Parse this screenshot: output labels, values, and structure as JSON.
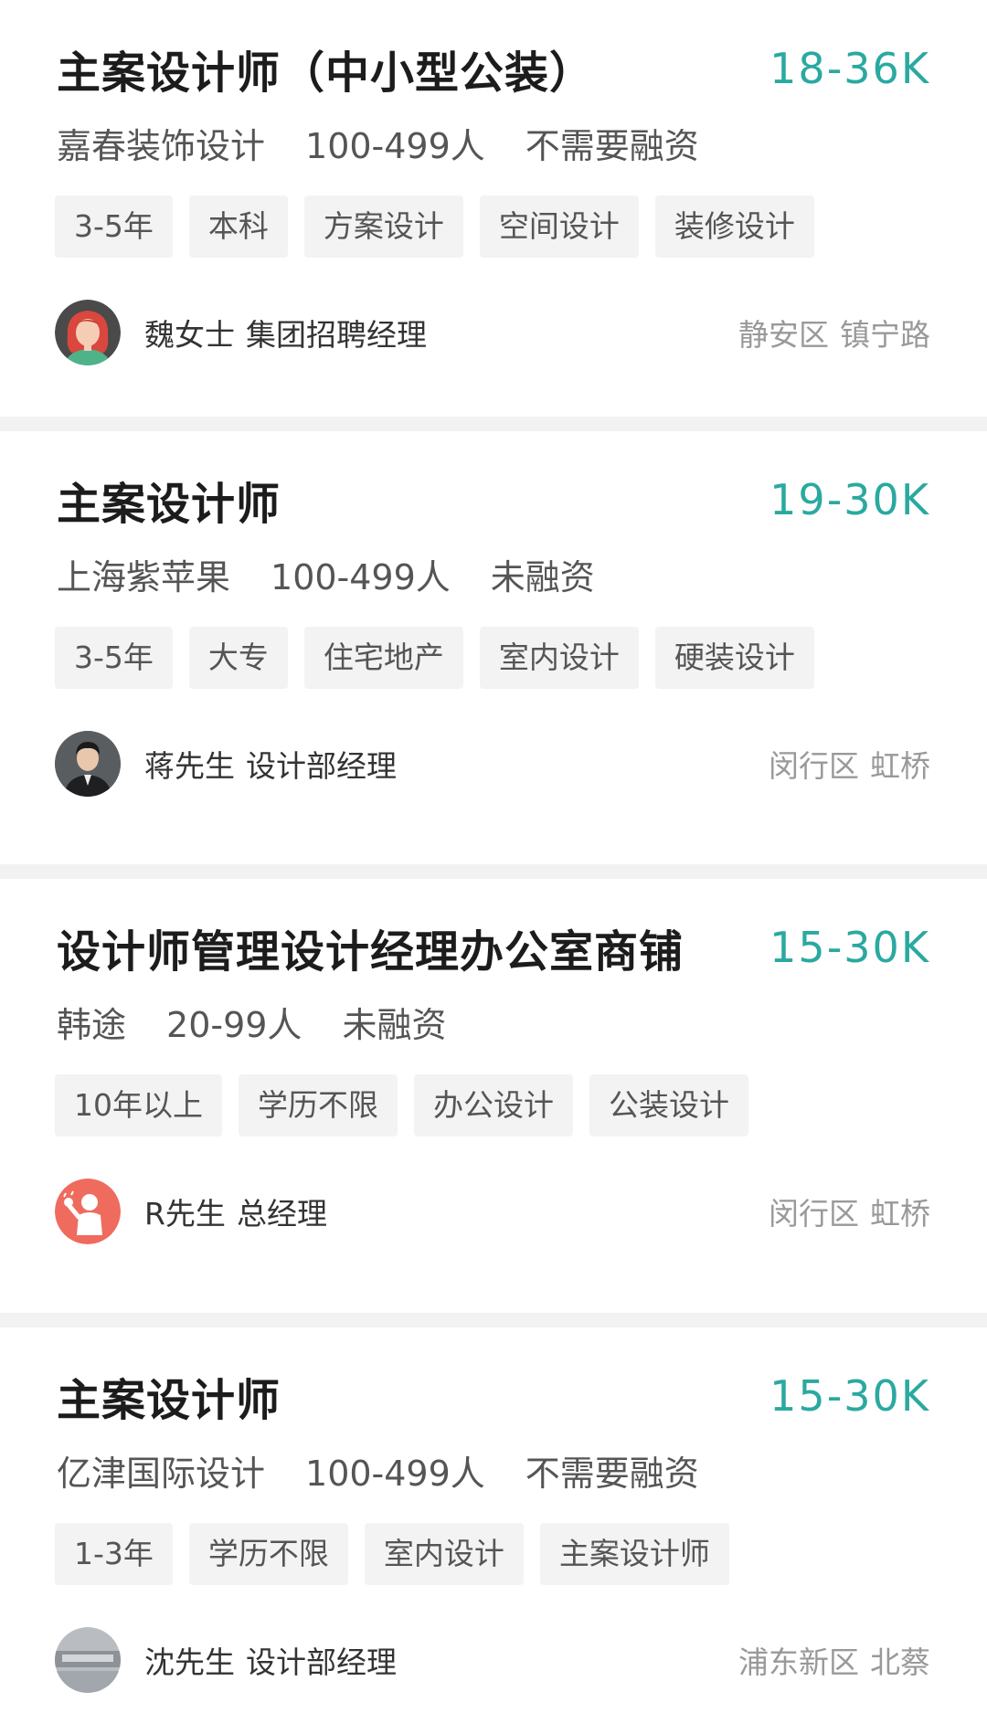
{
  "jobs": [
    {
      "title": "主案设计师（中小型公装）",
      "salary": "18-36K",
      "company": "嘉春装饰设计",
      "size": "100-499人",
      "funding": "不需要融资",
      "tags": [
        "3-5年",
        "本科",
        "方案设计",
        "空间设计",
        "装修设计"
      ],
      "recruiter_name": "魏女士",
      "recruiter_title": "集团招聘经理",
      "district": "静安区",
      "area": "镇宁路",
      "avatar_icon": "woman-avatar-icon"
    },
    {
      "title": "主案设计师",
      "salary": "19-30K",
      "company": "上海紫苹果",
      "size": "100-499人",
      "funding": "未融资",
      "tags": [
        "3-5年",
        "大专",
        "住宅地产",
        "室内设计",
        "硬装设计"
      ],
      "recruiter_name": "蒋先生",
      "recruiter_title": "设计部经理",
      "district": "闵行区",
      "area": "虹桥",
      "avatar_icon": "man-photo-avatar-icon"
    },
    {
      "title": "设计师管理设计经理办公室商铺",
      "salary": "15-30K",
      "company": "韩途",
      "size": "20-99人",
      "funding": "未融资",
      "tags": [
        "10年以上",
        "学历不限",
        "办公设计",
        "公装设计"
      ],
      "recruiter_name": "R先生",
      "recruiter_title": "总经理",
      "district": "闵行区",
      "area": "虹桥",
      "avatar_icon": "person-illustration-avatar-icon"
    },
    {
      "title": "主案设计师",
      "salary": "15-30K",
      "company": "亿津国际设计",
      "size": "100-499人",
      "funding": "不需要融资",
      "tags": [
        "1-3年",
        "学历不限",
        "室内设计",
        "主案设计师"
      ],
      "recruiter_name": "沈先生",
      "recruiter_title": "设计部经理",
      "district": "浦东新区",
      "area": "北蔡",
      "avatar_icon": "building-photo-avatar-icon"
    }
  ],
  "colors": {
    "salary": "#2aa9a0",
    "tag_bg": "#f3f3f3",
    "divider": "#f2f2f2"
  }
}
